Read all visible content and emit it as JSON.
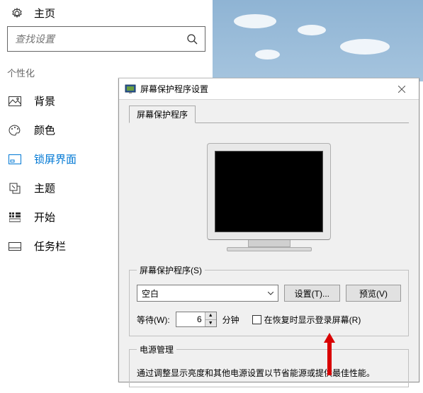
{
  "header": {
    "title": "主页"
  },
  "search": {
    "placeholder": "查找设置"
  },
  "section": "个性化",
  "nav": [
    {
      "label": "背景"
    },
    {
      "label": "颜色"
    },
    {
      "label": "锁屏界面"
    },
    {
      "label": "主题"
    },
    {
      "label": "开始"
    },
    {
      "label": "任务栏"
    }
  ],
  "dialog": {
    "title": "屏幕保护程序设置",
    "tab": "屏幕保护程序",
    "group1_title": "屏幕保护程序(S)",
    "dropdown_value": "空白",
    "btn_settings": "设置(T)...",
    "btn_preview": "预览(V)",
    "wait_label": "等待(W):",
    "wait_value": "6",
    "wait_unit": "分钟",
    "resume_checkbox": "在恢复时显示登录屏幕(R)",
    "group2_title": "电源管理",
    "power_desc": "通过调整显示亮度和其他电源设置以节省能源或提供最佳性能。"
  }
}
